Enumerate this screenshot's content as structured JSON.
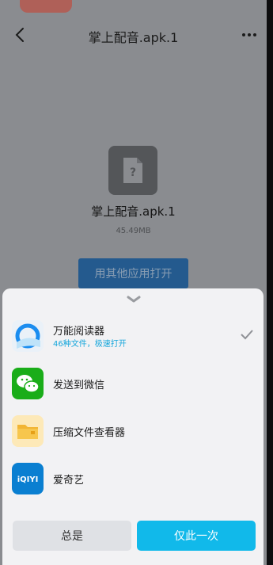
{
  "header": {
    "title": "掌上配音.apk.1"
  },
  "file": {
    "name": "掌上配音.apk.1",
    "size": "45.49MB",
    "icon": "unknown-file-icon",
    "glyph": "?"
  },
  "open_other_label": "用其他应用打开",
  "sheet": {
    "apps": [
      {
        "name": "万能阅读器",
        "subtitle": "46种文件，极速打开",
        "icon": "qq-browser-icon",
        "selected": true
      },
      {
        "name": "发送到微信",
        "icon": "wechat-icon"
      },
      {
        "name": "压缩文件查看器",
        "icon": "folder-icon"
      },
      {
        "name": "爱奇艺",
        "icon": "iqiyi-icon",
        "icon_text": "iQIYI"
      }
    ],
    "always_label": "总是",
    "once_label": "仅此一次"
  },
  "colors": {
    "accent": "#11b9ea",
    "wechat": "#1aad19",
    "iqiyi": "#0a7fd1"
  }
}
